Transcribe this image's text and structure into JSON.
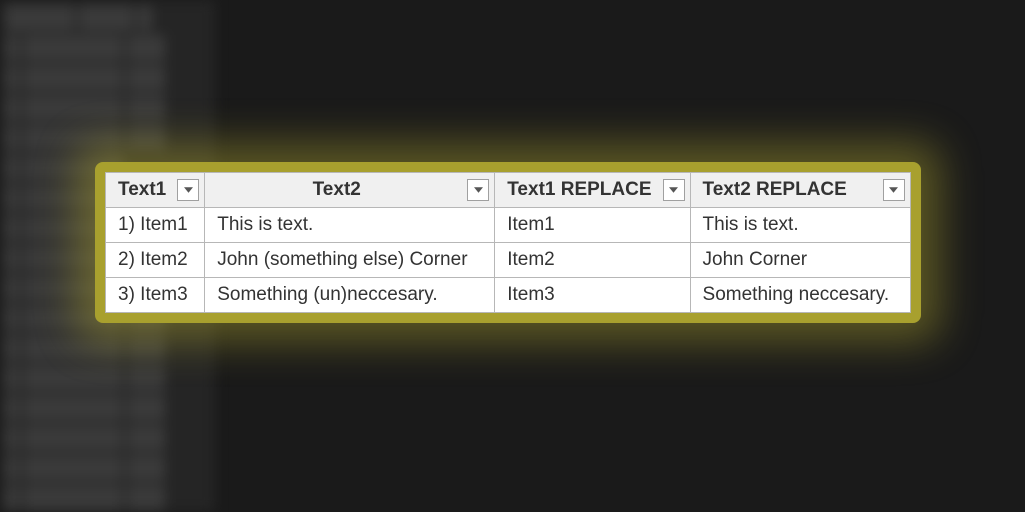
{
  "table": {
    "headers": [
      "Text1",
      "Text2",
      "Text1 REPLACE",
      "Text2 REPLACE"
    ],
    "rows": [
      {
        "c1": "1) Item1",
        "c2": "This is text.",
        "c3": "Item1",
        "c4": "This is text."
      },
      {
        "c1": "2) Item2",
        "c2": "John (something else) Corner",
        "c3": "Item2",
        "c4": "John Corner"
      },
      {
        "c1": "3) Item3",
        "c2": "Something (un)neccesary.",
        "c3": "Item3",
        "c4": "Something neccesary."
      }
    ]
  },
  "colors": {
    "glow": "#a8a02e",
    "headerBg": "#f0f0f0",
    "border": "#b7b7b7",
    "bgDark": "#1a1a1a"
  }
}
